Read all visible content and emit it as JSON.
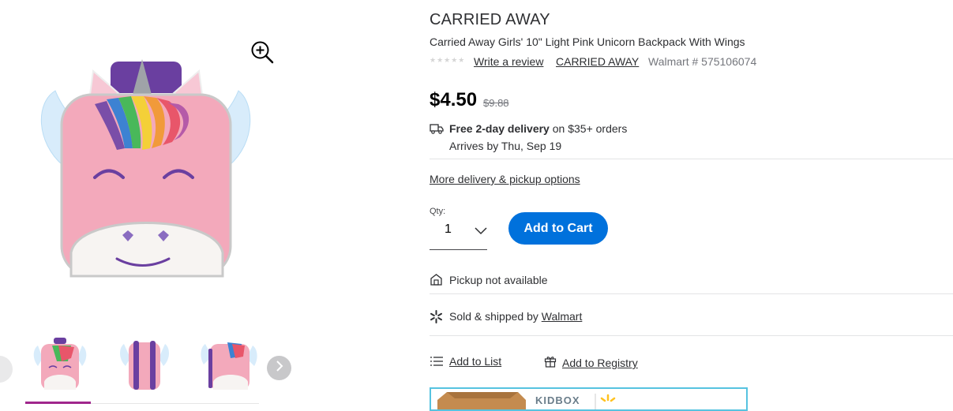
{
  "product": {
    "brand": "CARRIED AWAY",
    "title": "Carried Away Girls' 10\" Light Pink Unicorn Backpack With Wings",
    "stars": "★★★★★",
    "write_review": "Write a review",
    "brand_link": "CARRIED AWAY",
    "walmart_number": "Walmart # 575106074"
  },
  "pricing": {
    "price": "$4.50",
    "was_price": "$9.88"
  },
  "delivery": {
    "free_label": "Free 2-day delivery",
    "threshold": " on $35+ orders",
    "arrives": "Arrives by Thu, Sep 19",
    "more_options": "More delivery & pickup options"
  },
  "cart": {
    "qty_label": "Qty:",
    "qty_value": "1",
    "add_to_cart": "Add to Cart"
  },
  "fulfillment": {
    "pickup": "Pickup not available",
    "sold_prefix": "Sold & shipped by ",
    "seller": "Walmart"
  },
  "actions": {
    "add_to_list": "Add to List",
    "add_to_registry": "Add to Registry"
  },
  "banner": {
    "logo_text": "KIDBOX"
  },
  "colors": {
    "accent_blue": "#0071dc",
    "thumb_selected": "#a0268c",
    "spark_yellow": "#ffc220",
    "banner_border": "#56c3e0"
  },
  "icons": [
    "zoom-in-icon",
    "chevron-left-icon",
    "chevron-right-icon",
    "truck-icon",
    "chevron-down-icon",
    "store-icon",
    "walmart-spark-icon",
    "list-icon",
    "gift-icon"
  ]
}
